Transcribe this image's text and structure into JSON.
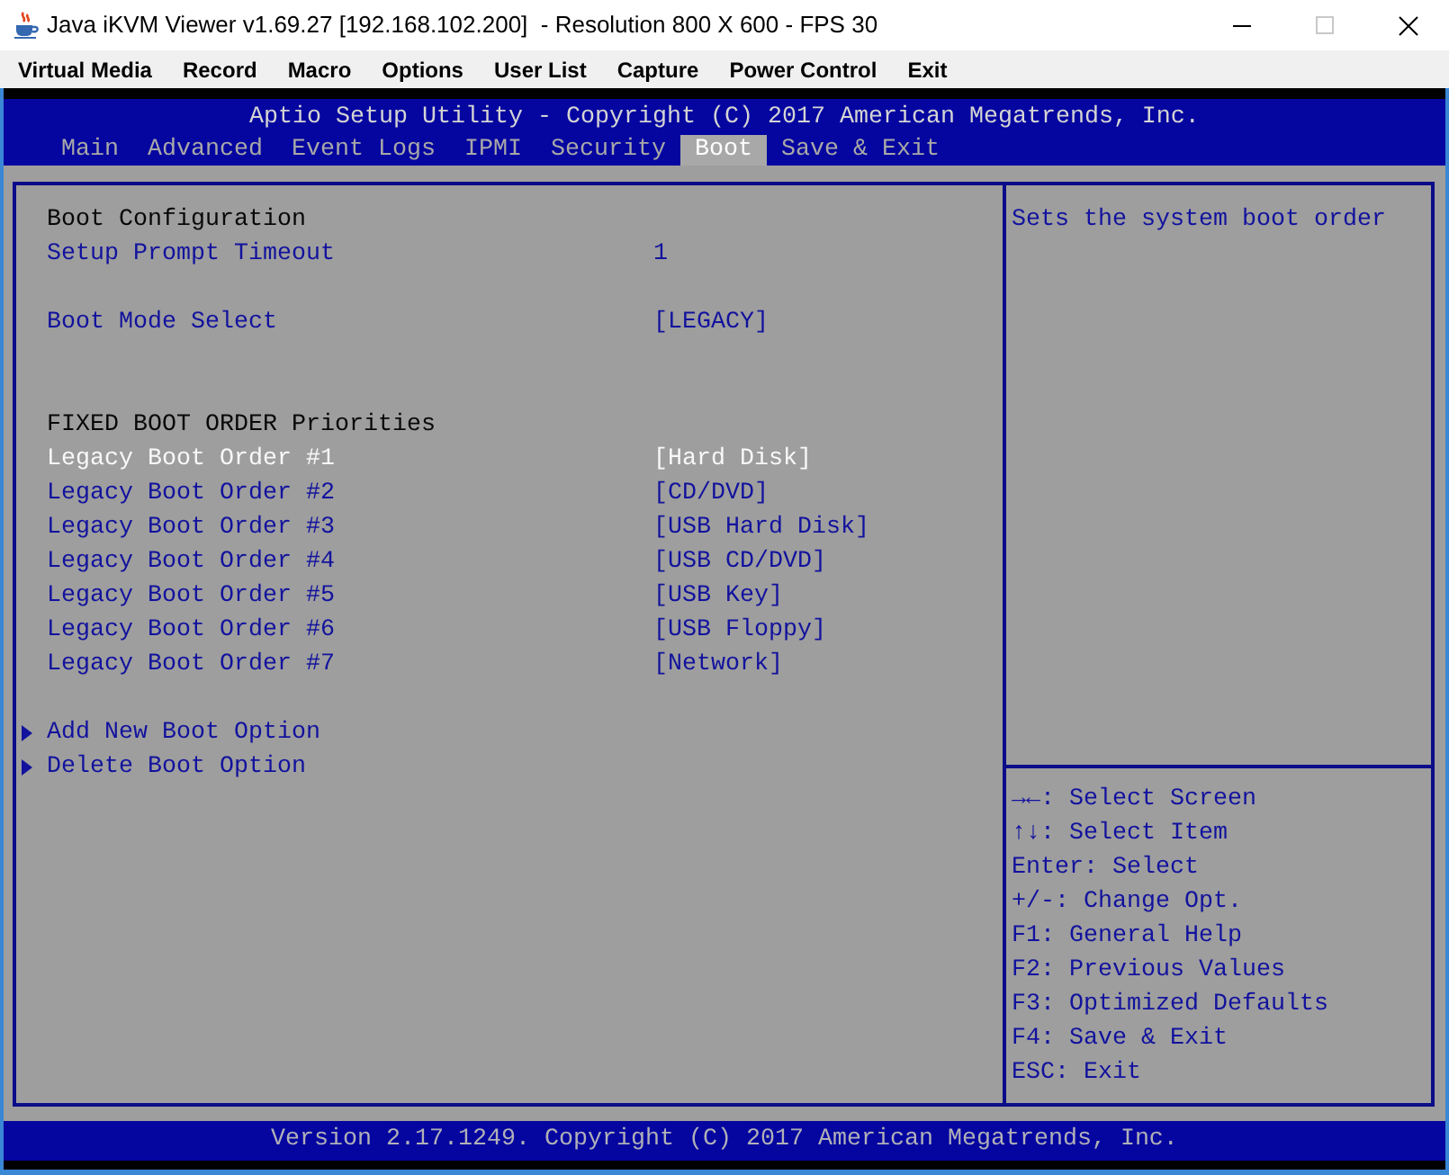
{
  "window": {
    "title": "Java iKVM Viewer v1.69.27 [192.168.102.200]  - Resolution 800 X 600 - FPS 30"
  },
  "menu_bar": [
    "Virtual Media",
    "Record",
    "Macro",
    "Options",
    "User List",
    "Capture",
    "Power Control",
    "Exit"
  ],
  "bios": {
    "title": "Aptio Setup Utility - Copyright (C) 2017 American Megatrends, Inc.",
    "tabs": [
      {
        "label": "Main",
        "selected": false
      },
      {
        "label": "Advanced",
        "selected": false
      },
      {
        "label": "Event Logs",
        "selected": false
      },
      {
        "label": "IPMI",
        "selected": false
      },
      {
        "label": "Security",
        "selected": false
      },
      {
        "label": "Boot",
        "selected": true
      },
      {
        "label": "Save & Exit",
        "selected": false
      }
    ],
    "items": [
      {
        "kind": "heading",
        "label": "Boot Configuration"
      },
      {
        "kind": "setting",
        "label": "Setup Prompt Timeout",
        "value": "1",
        "selected": false
      },
      {
        "kind": "blank"
      },
      {
        "kind": "setting",
        "label": "Boot Mode Select",
        "value": "[LEGACY]",
        "selected": false
      },
      {
        "kind": "blank"
      },
      {
        "kind": "blank"
      },
      {
        "kind": "heading",
        "label": "FIXED BOOT ORDER Priorities"
      },
      {
        "kind": "setting",
        "label": "Legacy Boot Order #1",
        "value": "[Hard Disk]",
        "selected": true
      },
      {
        "kind": "setting",
        "label": "Legacy Boot Order #2",
        "value": "[CD/DVD]",
        "selected": false
      },
      {
        "kind": "setting",
        "label": "Legacy Boot Order #3",
        "value": "[USB Hard Disk]",
        "selected": false
      },
      {
        "kind": "setting",
        "label": "Legacy Boot Order #4",
        "value": "[USB CD/DVD]",
        "selected": false
      },
      {
        "kind": "setting",
        "label": "Legacy Boot Order #5",
        "value": "[USB Key]",
        "selected": false
      },
      {
        "kind": "setting",
        "label": "Legacy Boot Order #6",
        "value": "[USB Floppy]",
        "selected": false
      },
      {
        "kind": "setting",
        "label": "Legacy Boot Order #7",
        "value": "[Network]",
        "selected": false
      },
      {
        "kind": "blank"
      },
      {
        "kind": "submenu",
        "label": "Add New Boot Option",
        "selected": false
      },
      {
        "kind": "submenu",
        "label": "Delete Boot Option",
        "selected": false
      }
    ],
    "help": "Sets the system boot order",
    "key_hints": [
      "→←: Select Screen",
      "↑↓: Select Item",
      "Enter: Select",
      "+/-: Change Opt.",
      "F1: General Help",
      "F2: Previous Values",
      "F3: Optimized Defaults",
      "F4: Save & Exit",
      "ESC: Exit"
    ],
    "footer": "Version 2.17.1249. Copyright (C) 2017 American Megatrends, Inc."
  }
}
